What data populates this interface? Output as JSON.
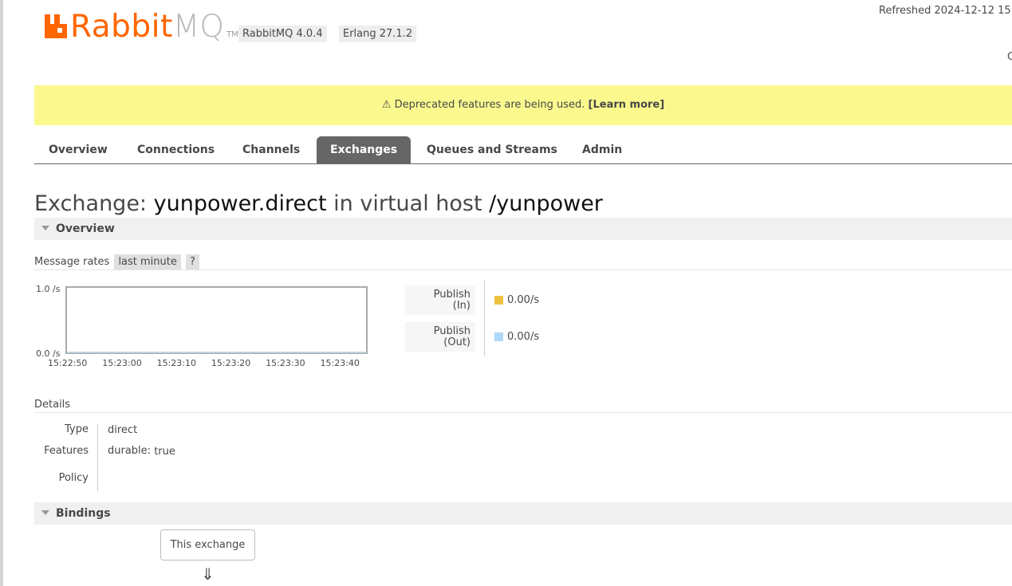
{
  "header": {
    "logo_rabbit": "Rabbit",
    "logo_mq": "MQ",
    "logo_tm": "TM",
    "version_rabbitmq": "RabbitMQ 4.0.4",
    "version_erlang": "Erlang 27.1.2",
    "refreshed": "Refreshed 2024-12-12 15",
    "corner_text": "C"
  },
  "banner": {
    "text": "⚠ Deprecated features are being used.",
    "link": "[Learn more]"
  },
  "tabs": [
    {
      "label": "Overview"
    },
    {
      "label": "Connections"
    },
    {
      "label": "Channels"
    },
    {
      "label": "Exchanges"
    },
    {
      "label": "Queues and Streams"
    },
    {
      "label": "Admin"
    }
  ],
  "title": {
    "prefix": "Exchange:",
    "exchange_name": "yunpower.direct",
    "middle": "in virtual host",
    "vhost": "/yunpower"
  },
  "overview": {
    "header": "Overview",
    "message_rates_label": "Message rates",
    "range_pill": "last minute",
    "help_pill": "?"
  },
  "chart_data": {
    "type": "line",
    "y_tick_labels": [
      "1.0 /s",
      "0.0 /s"
    ],
    "ylim": [
      0,
      1
    ],
    "x": [
      "15:22:50",
      "15:23:00",
      "15:23:10",
      "15:23:20",
      "15:23:30",
      "15:23:40"
    ],
    "series": [
      {
        "name": "Publish (In)",
        "values": [
          0,
          0,
          0,
          0,
          0,
          0
        ],
        "color": "#edc240"
      },
      {
        "name": "Publish (Out)",
        "values": [
          0,
          0,
          0,
          0,
          0,
          0
        ],
        "color": "#afd8f8"
      }
    ]
  },
  "legend": [
    {
      "label_line1": "Publish",
      "label_line2": "(In)",
      "value": "0.00/s",
      "color": "#edc240"
    },
    {
      "label_line1": "Publish",
      "label_line2": "(Out)",
      "value": "0.00/s",
      "color": "#afd8f8"
    }
  ],
  "details": {
    "header": "Details",
    "type_label": "Type",
    "type_value": "direct",
    "features_label": "Features",
    "features_key": "durable:",
    "features_value": "true",
    "policy_label": "Policy"
  },
  "bindings": {
    "header": "Bindings",
    "this_exchange": "This exchange",
    "arrow": "⇓"
  }
}
